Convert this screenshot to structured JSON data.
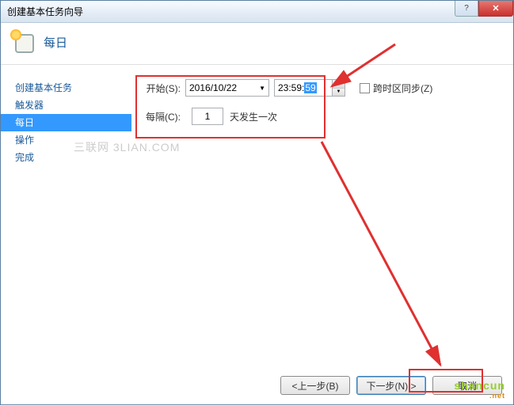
{
  "window": {
    "title": "创建基本任务向导"
  },
  "header": {
    "title": "每日"
  },
  "sidebar": {
    "items": [
      {
        "label": "创建基本任务"
      },
      {
        "label": "触发器"
      },
      {
        "label": "每日"
      },
      {
        "label": "操作"
      },
      {
        "label": "完成"
      }
    ]
  },
  "form": {
    "start_label": "开始(S):",
    "date_value": "2016/10/22",
    "time_prefix": "23:59:",
    "time_selected": "59",
    "sync_checkbox_label": "跨时区同步(Z)",
    "interval_label": "每隔(C):",
    "interval_value": "1",
    "interval_suffix": "天发生一次"
  },
  "buttons": {
    "back": "<上一步(B)",
    "next": "下一步(N) >",
    "cancel": "取消"
  },
  "watermark": "三联网 3LIAN.COM",
  "watermark2": "shancun"
}
